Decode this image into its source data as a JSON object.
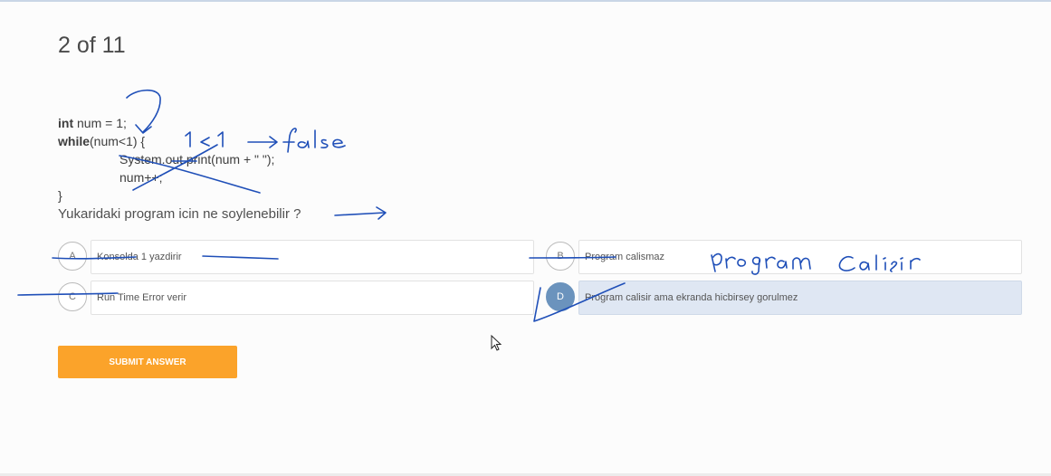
{
  "quiz": {
    "counter": "2 of 11",
    "code": {
      "l1_kw": "int",
      "l1_rest": " num = 1;",
      "l2_kw": "while",
      "l2_rest": "(num<1) {",
      "l3": "System.out.print(num + \" \");",
      "l4": "num++;",
      "l5": "}"
    },
    "question": "Yukaridaki program icin ne soylenebilir ?",
    "options": [
      {
        "letter": "A",
        "text": "Konsolda 1 yazdirir"
      },
      {
        "letter": "B",
        "text": "Program calismaz"
      },
      {
        "letter": "C",
        "text": "Run Time Error verir"
      },
      {
        "letter": "D",
        "text": "Program calisir ama ekranda hicbirsey gorulmez"
      }
    ],
    "selected": "D",
    "submit_label": "SUBMIT ANSWER"
  },
  "annotations": {
    "ink_color": "#1f4fb8",
    "note_condition": "1 < 1 → false",
    "note_option_b": "program calışır"
  }
}
